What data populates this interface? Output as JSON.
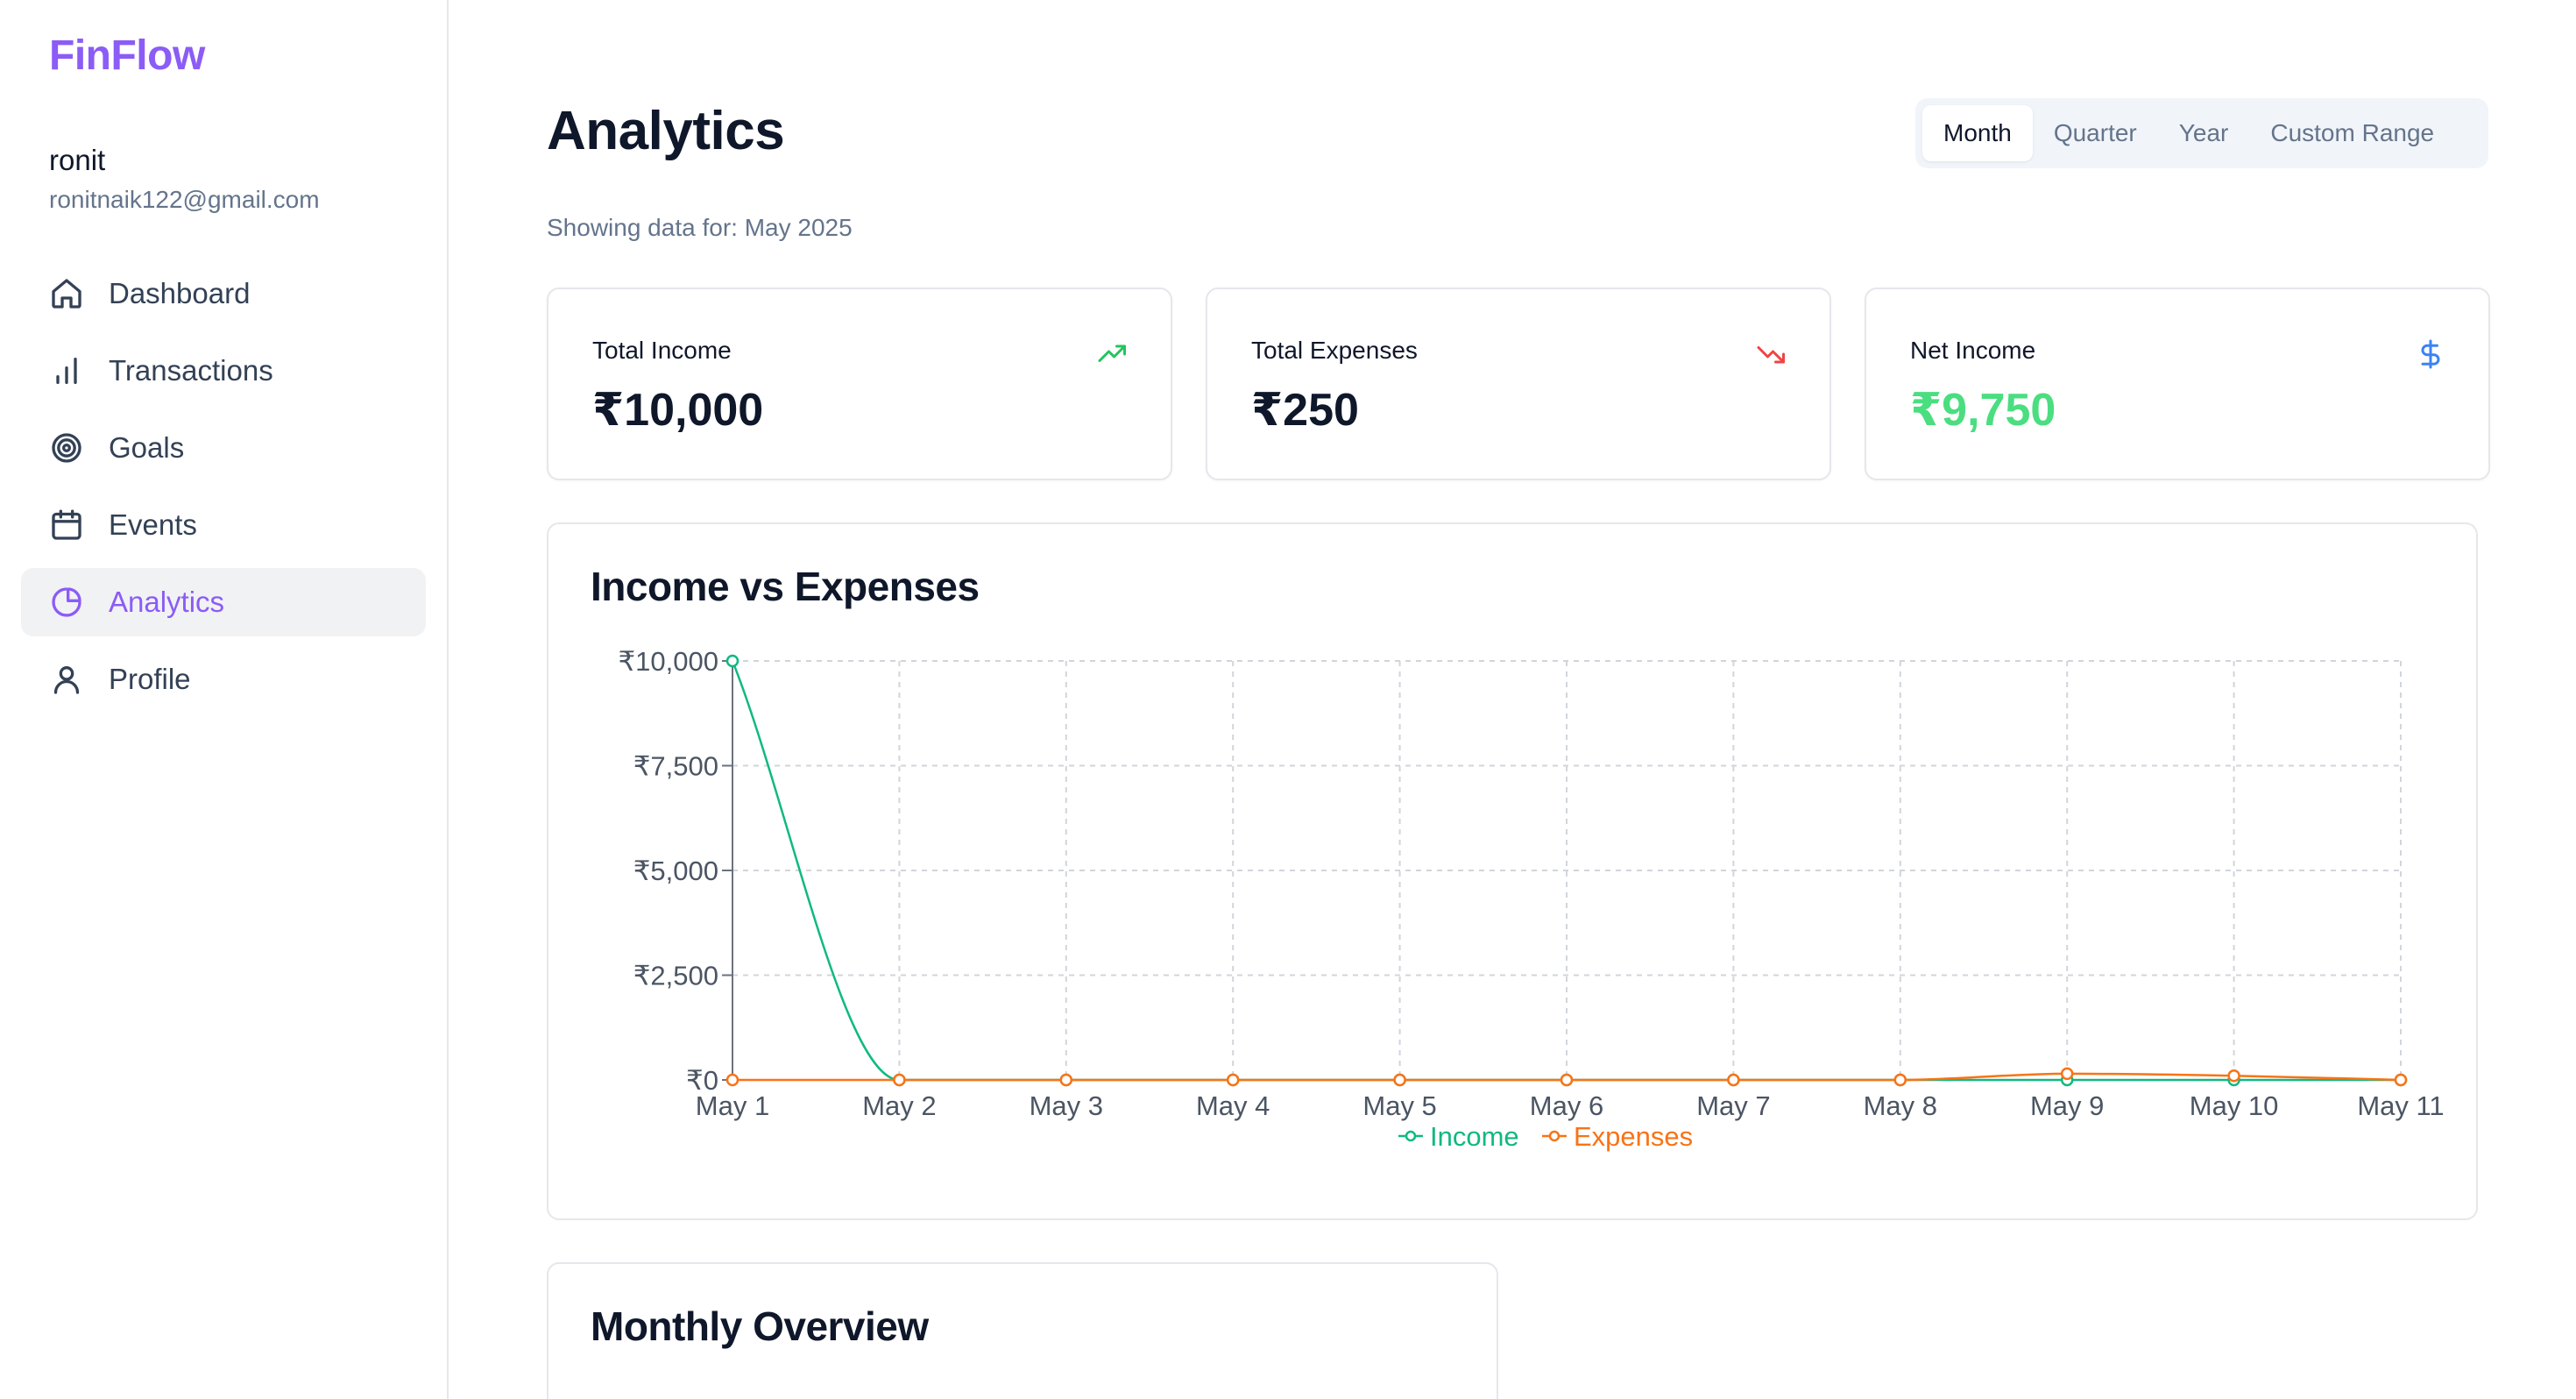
{
  "brand": {
    "name": "FinFlow"
  },
  "user": {
    "name": "ronit",
    "email": "ronitnaik122@gmail.com"
  },
  "sidebar": {
    "items": [
      {
        "label": "Dashboard",
        "icon": "home-icon",
        "active": false
      },
      {
        "label": "Transactions",
        "icon": "bar-chart-icon",
        "active": false
      },
      {
        "label": "Goals",
        "icon": "target-icon",
        "active": false
      },
      {
        "label": "Events",
        "icon": "calendar-icon",
        "active": false
      },
      {
        "label": "Analytics",
        "icon": "pie-chart-icon",
        "active": true
      },
      {
        "label": "Profile",
        "icon": "user-icon",
        "active": false
      }
    ]
  },
  "header": {
    "title": "Analytics",
    "subtitle": "Showing data for: May 2025",
    "period_tabs": [
      {
        "label": "Month",
        "active": true
      },
      {
        "label": "Quarter",
        "active": false
      },
      {
        "label": "Year",
        "active": false
      },
      {
        "label": "Custom Range",
        "active": false
      }
    ]
  },
  "stats": [
    {
      "label": "Total Income",
      "value": "₹10,000",
      "icon": "trending-up-icon",
      "color": "#22c55e"
    },
    {
      "label": "Total Expenses",
      "value": "₹250",
      "icon": "trending-down-icon",
      "color": "#ef4444"
    },
    {
      "label": "Net Income",
      "value": "₹9,750",
      "icon": "dollar-icon",
      "color": "#3b82f6"
    }
  ],
  "colors": {
    "accent": "#8b5cf6",
    "income": "#10b981",
    "expenses": "#f97316",
    "net_positive": "#22c55e"
  },
  "income_vs_expenses": {
    "title": "Income vs Expenses",
    "chart_data": {
      "type": "line",
      "title": "Income vs Expenses",
      "categories": [
        "May 1",
        "May 2",
        "May 3",
        "May 4",
        "May 5",
        "May 6",
        "May 7",
        "May 8",
        "May 9",
        "May 10",
        "May 11"
      ],
      "yticks": [
        "₹0",
        "₹2,500",
        "₹5,000",
        "₹7,500",
        "₹10,000"
      ],
      "ylim": [
        0,
        10000
      ],
      "grid": true,
      "legend": "bottom-center",
      "series": [
        {
          "name": "Income",
          "color": "#10b981",
          "values": [
            10000,
            0,
            0,
            0,
            0,
            0,
            0,
            0,
            0,
            0,
            0
          ]
        },
        {
          "name": "Expenses",
          "color": "#f97316",
          "values": [
            0,
            0,
            0,
            0,
            0,
            0,
            0,
            0,
            150,
            100,
            0
          ]
        }
      ]
    }
  },
  "monthly_overview": {
    "title": "Monthly Overview"
  }
}
